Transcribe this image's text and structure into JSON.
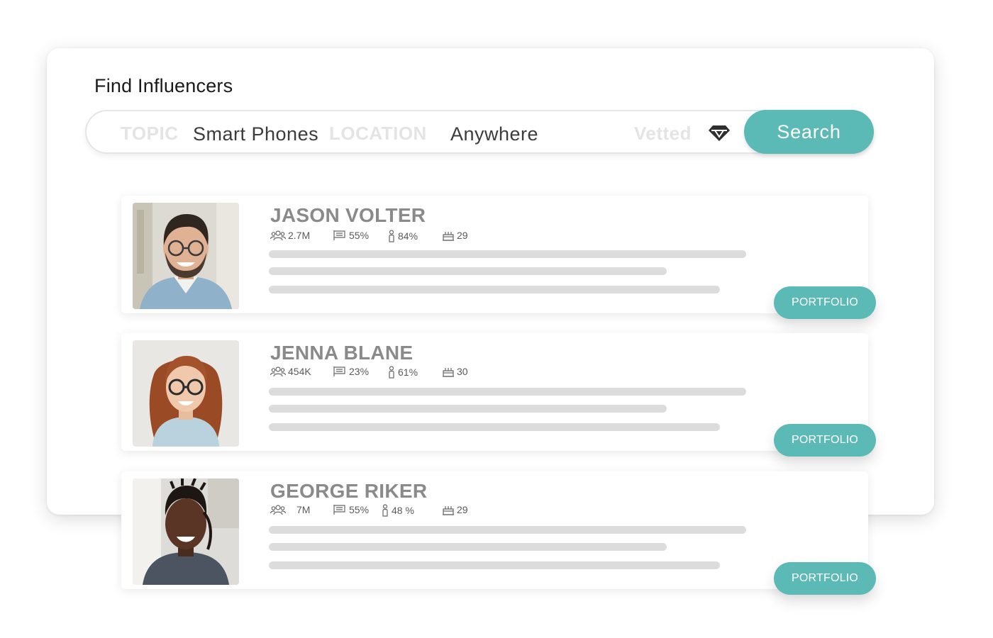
{
  "page": {
    "title": "Find Influencers"
  },
  "search": {
    "topic_label": "TOPIC",
    "topic_value": "Smart Phones",
    "location_label": "LOCATION",
    "location_value": "Anywhere",
    "vetted_label": "Vetted",
    "vetted_icon": "diamond-icon",
    "button_label": "Search"
  },
  "colors": {
    "accent": "#5cbab6",
    "placeholder_bar": "#dcdcdc",
    "name_text": "#8a8a8a"
  },
  "icons": {
    "followers": "users-icon",
    "country": "flag-icon",
    "gender": "person-icon",
    "age": "cake-icon"
  },
  "influencers": [
    {
      "name": "JASON VOLTER",
      "followers": "2.7M",
      "country": "55%",
      "gender": "84%",
      "age": "29",
      "button_label": "PORTFOLIO",
      "photo": "man-with-glasses-smiling-avatar"
    },
    {
      "name": "JENNA BLANE",
      "followers": "454K",
      "country": "23%",
      "gender": "61%",
      "age": "30",
      "button_label": "PORTFOLIO",
      "photo": "red-haired-woman-with-glasses-avatar"
    },
    {
      "name": "GEORGE RIKER",
      "followers": "7M",
      "country": "55%",
      "gender": "48 %",
      "age": "29",
      "button_label": "PORTFOLIO",
      "photo": "smiling-man-with-locs-avatar"
    }
  ]
}
